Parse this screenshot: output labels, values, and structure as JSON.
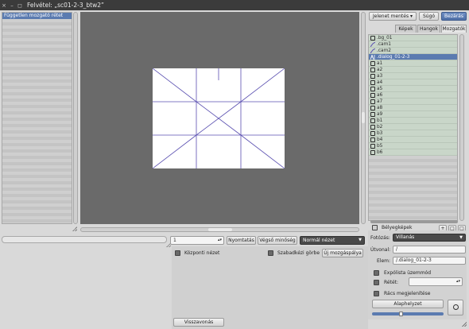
{
  "window": {
    "title": "Felvétel: „sc01-2-3_btw2”",
    "controls": [
      "×",
      "–",
      "◻"
    ]
  },
  "left_panel": {
    "items": [
      "Független mozgató rétet"
    ]
  },
  "toolbar": {
    "save_scene": "Jelenet mentés",
    "help": "Súgó",
    "close": "Bezárás"
  },
  "tabs": [
    "Képek",
    "Hangok",
    "Mozgatók"
  ],
  "assets": [
    {
      "label": ".bg_01",
      "icon": "square-icon"
    },
    {
      "label": ".cam1",
      "icon": "camera-path-icon"
    },
    {
      "label": ".cam2",
      "icon": "camera-path-icon"
    },
    {
      "label": ".dialog_01-2-3",
      "icon": "dialog-icon",
      "selected": true
    },
    {
      "label": "a1",
      "icon": "square-icon"
    },
    {
      "label": "a2",
      "icon": "square-icon"
    },
    {
      "label": "a3",
      "icon": "square-icon"
    },
    {
      "label": "a4",
      "icon": "square-icon"
    },
    {
      "label": "a5",
      "icon": "square-icon"
    },
    {
      "label": "a6",
      "icon": "square-icon"
    },
    {
      "label": "a7",
      "icon": "square-icon"
    },
    {
      "label": "a8",
      "icon": "square-icon"
    },
    {
      "label": "a9",
      "icon": "square-icon"
    },
    {
      "label": "b1",
      "icon": "square-icon"
    },
    {
      "label": "b2",
      "icon": "square-icon"
    },
    {
      "label": "b3",
      "icon": "square-icon"
    },
    {
      "label": "b4",
      "icon": "square-icon"
    },
    {
      "label": "b5",
      "icon": "square-icon"
    },
    {
      "label": "b6",
      "icon": "square-icon"
    }
  ],
  "thumbnails": {
    "label": "Bélyegképek",
    "buttons": [
      "+",
      "□",
      "□"
    ]
  },
  "properties": {
    "lighting_label": "Fotózás:",
    "lighting_value": "Villanás",
    "path_label": "Útvonal:",
    "path_value": "/",
    "element_label": "Elem:",
    "element_value": "/.dialog_01-2-3",
    "exposure_mode": "Expólista üzemmód",
    "layer_label": "Rétét:",
    "grid_label": "Rács megjelenítése",
    "default_button": "Alaphelyzet"
  },
  "bottom_toolbar": {
    "frame_value": "1",
    "print_button": "Nyomtatás",
    "final_quality_button": "Végső minőség",
    "view_mode": "Normál nézet",
    "center_view": "Központi nézet",
    "freehand_curve": "Szabadkézi görbe",
    "new_track": "Új mozgáspálya",
    "undo": "Visszavonás"
  },
  "colors": {
    "selection": "#5b7bb0",
    "stage": "#6a6a6a",
    "canvas_lines": "#5a4fb0",
    "titlebar": "#3b3b3b"
  }
}
